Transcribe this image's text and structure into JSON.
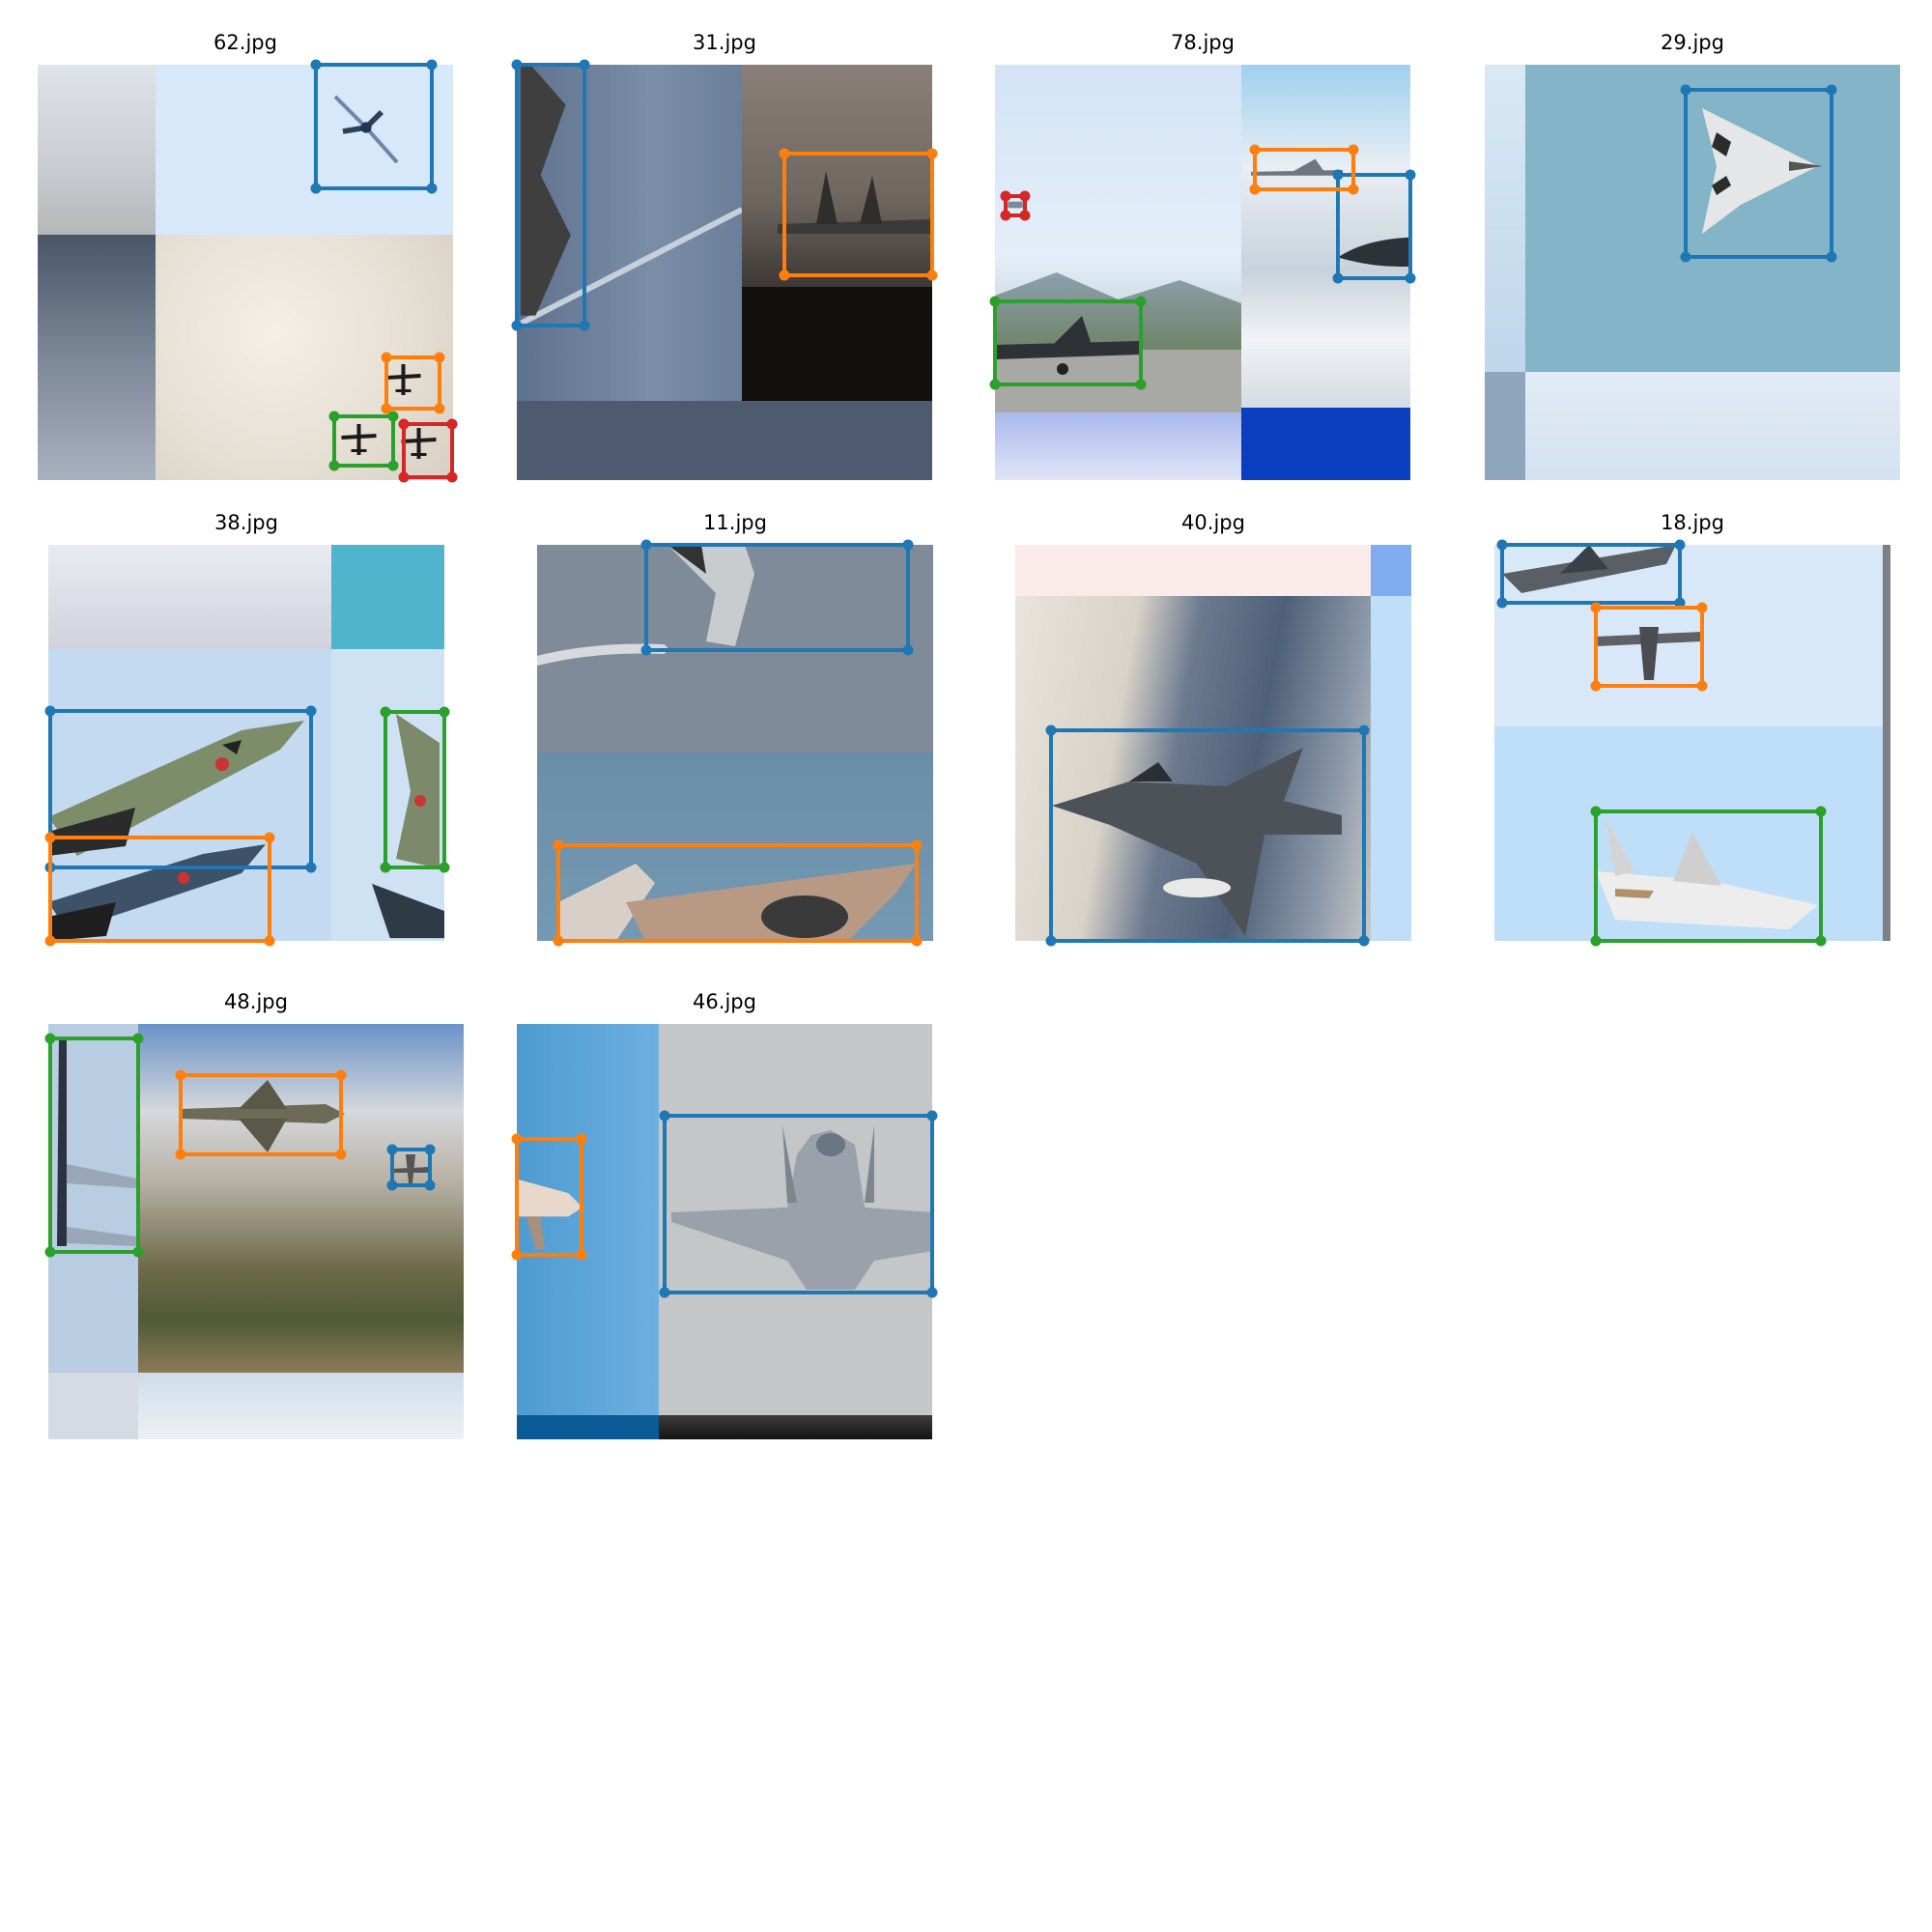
{
  "figure": {
    "panels": [
      {
        "filename": "62.jpg",
        "scene": [
          "cloud-gray",
          "sky-pale",
          "cloud-dark",
          "cloud-beige"
        ],
        "boxes": [
          {
            "color": "#1f77b4",
            "object": "propeller-plane-icon"
          },
          {
            "color": "#ff7f0e",
            "object": "bomber-silhouette-icon"
          },
          {
            "color": "#2ca02c",
            "object": "bomber-silhouette-icon"
          },
          {
            "color": "#d62728",
            "object": "bomber-silhouette-icon"
          }
        ]
      },
      {
        "filename": "31.jpg",
        "scene": [
          "steel-blue",
          "dusk-brown",
          "night-dark",
          "slate-blue"
        ],
        "boxes": [
          {
            "color": "#1f77b4",
            "object": "fighter-tail-icon"
          },
          {
            "color": "#ff7f0e",
            "object": "stealth-fighter-icon"
          }
        ]
      },
      {
        "filename": "78.jpg",
        "scene": [
          "sky-light",
          "runway-mountains",
          "snowy-peaks",
          "sky-lavender",
          "deep-blue"
        ],
        "boxes": [
          {
            "color": "#1f77b4",
            "object": "jet-nose-icon"
          },
          {
            "color": "#ff7f0e",
            "object": "fighter-jet-icon"
          },
          {
            "color": "#2ca02c",
            "object": "stealth-fighter-icon"
          },
          {
            "color": "#d62728",
            "object": "small-aircraft-icon"
          }
        ]
      },
      {
        "filename": "29.jpg",
        "scene": [
          "sky-pale",
          "teal-sky",
          "cloud-white"
        ],
        "boxes": [
          {
            "color": "#1f77b4",
            "object": "fighter-jet-icon"
          }
        ]
      },
      {
        "filename": "38.jpg",
        "scene": [
          "cloud-gray",
          "cyan",
          "sky-blue"
        ],
        "boxes": [
          {
            "color": "#1f77b4",
            "object": "phantom-jet-icon"
          },
          {
            "color": "#ff7f0e",
            "object": "phantom-jet-icon"
          },
          {
            "color": "#2ca02c",
            "object": "phantom-jet-icon"
          }
        ]
      },
      {
        "filename": "11.jpg",
        "scene": [
          "gray-sky",
          "sea-blue"
        ],
        "boxes": [
          {
            "color": "#1f77b4",
            "object": "jet-wing-icon"
          },
          {
            "color": "#ff7f0e",
            "object": "trainer-jet-icon"
          }
        ]
      },
      {
        "filename": "40.jpg",
        "scene": [
          "pink-haze",
          "desert-mountains",
          "sky-blue"
        ],
        "boxes": [
          {
            "color": "#1f77b4",
            "object": "fighter-jet-icon"
          }
        ]
      },
      {
        "filename": "18.jpg",
        "scene": [
          "sky-pale",
          "sky-blue"
        ],
        "boxes": [
          {
            "color": "#1f77b4",
            "object": "jet-icon"
          },
          {
            "color": "#ff7f0e",
            "object": "propeller-fighter-icon"
          },
          {
            "color": "#2ca02c",
            "object": "business-jet-icon"
          }
        ]
      },
      {
        "filename": "48.jpg",
        "scene": [
          "sky-blue",
          "clouds-mountains",
          "snowy-ridge"
        ],
        "boxes": [
          {
            "color": "#1f77b4",
            "object": "small-aircraft-icon"
          },
          {
            "color": "#ff7f0e",
            "object": "fighter-jet-icon"
          },
          {
            "color": "#2ca02c",
            "object": "airliner-tail-icon"
          }
        ]
      },
      {
        "filename": "46.jpg",
        "scene": [
          "sky-blue",
          "light-gray",
          "mountain-dark"
        ],
        "boxes": [
          {
            "color": "#1f77b4",
            "object": "stealth-fighter-icon"
          },
          {
            "color": "#ff7f0e",
            "object": "business-jet-icon"
          }
        ]
      }
    ]
  }
}
